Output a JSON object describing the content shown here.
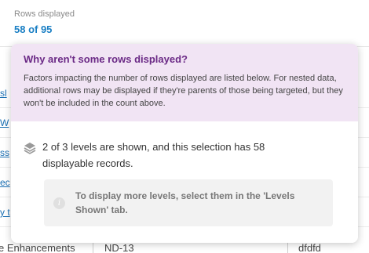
{
  "header": {
    "rows_label": "Rows displayed",
    "rows_count": "58 of 95"
  },
  "background_table": {
    "rows": [
      {
        "cell": "sl"
      },
      {
        "cell": "W"
      },
      {
        "cell": "ss"
      },
      {
        "cell": "ec"
      },
      {
        "cell": "y t"
      }
    ],
    "last_row": {
      "name": "e Enhancements",
      "code": "ND-13",
      "value": "dfdfd"
    }
  },
  "popover": {
    "title": "Why aren't some rows displayed?",
    "description": "Factors impacting the number of rows displayed are listed below. For nested data, additional rows may be displayed if they're parents of those being targeted, but they won't be included in the count above.",
    "levels_text": "2 of 3 levels are shown, and this selection has 58 displayable records.",
    "info_text": "To display more levels, select them in the 'Levels Shown' tab.",
    "info_icon_glyph": "i"
  },
  "colors": {
    "accent_link": "#1a7fc4",
    "popover_header_bg": "#f1e4f4",
    "popover_title": "#6b2a86"
  }
}
